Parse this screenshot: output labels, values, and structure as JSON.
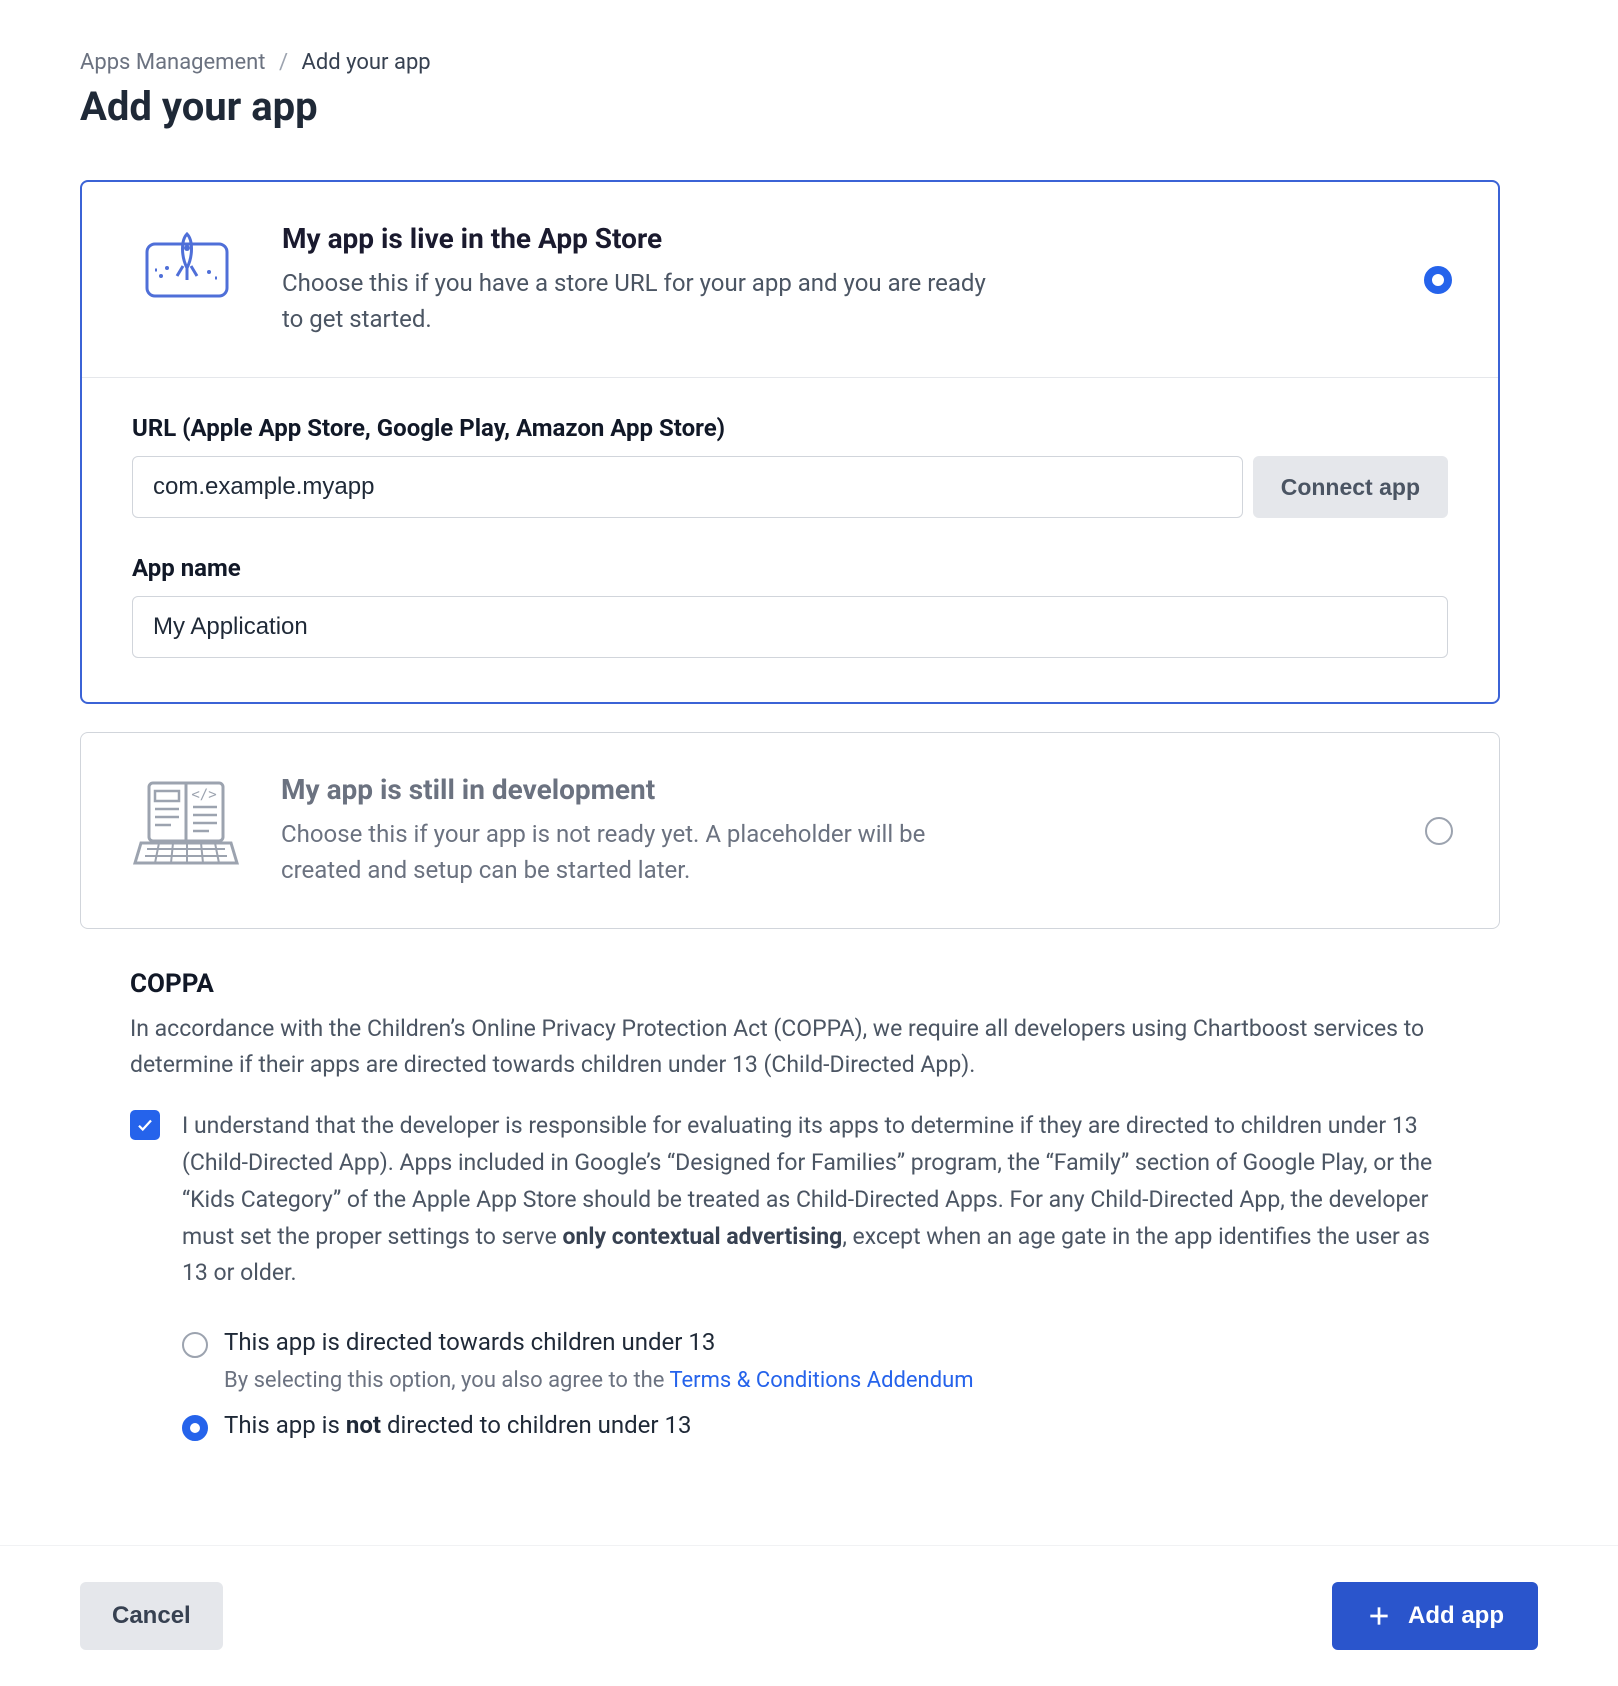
{
  "breadcrumb": {
    "parent": "Apps Management",
    "current": "Add your app"
  },
  "page_title": "Add your app",
  "options": {
    "live": {
      "title": "My app is live in the App Store",
      "desc": "Choose this if you have a store URL for your app and you are ready to get started.",
      "selected": true
    },
    "dev": {
      "title": "My app is still in development",
      "desc": "Choose this if your app is not ready yet. A placeholder will be created and setup can be started later.",
      "selected": false
    }
  },
  "form": {
    "url_label": "URL (Apple App Store, Google Play, Amazon App Store)",
    "url_value": "com.example.myapp",
    "connect_label": "Connect app",
    "name_label": "App name",
    "name_value": "My Application"
  },
  "coppa": {
    "title": "COPPA",
    "intro": "In accordance with the Children’s Online Privacy Protection Act (COPPA), we require all developers using Chartboost services to determine if their apps are directed towards children under 13 (Child-Directed App).",
    "ack_pre": "I understand that the developer is responsible for evaluating its apps to determine if they are directed to children under 13 (Child-Directed App). Apps included in Google’s “Designed for Families” program, the “Family” section of Google Play, or the “Kids Category” of the Apple App Store should be treated as Child-Directed Apps. For any Child-Directed App, the developer must set the proper settings to serve ",
    "ack_bold": "only contextual advertising",
    "ack_post": ", except when an age gate in the app identifies the user as 13 or older.",
    "ack_checked": true,
    "option_under": "This app is directed towards children under 13",
    "option_under_sub_pre": "By selecting this option, you also agree to the ",
    "option_under_sub_link": "Terms & Conditions Addendum",
    "option_not_pre": "This app is ",
    "option_not_bold": "not",
    "option_not_post": " directed to children under 13",
    "selected": "not"
  },
  "footer": {
    "cancel": "Cancel",
    "add": "Add app"
  }
}
